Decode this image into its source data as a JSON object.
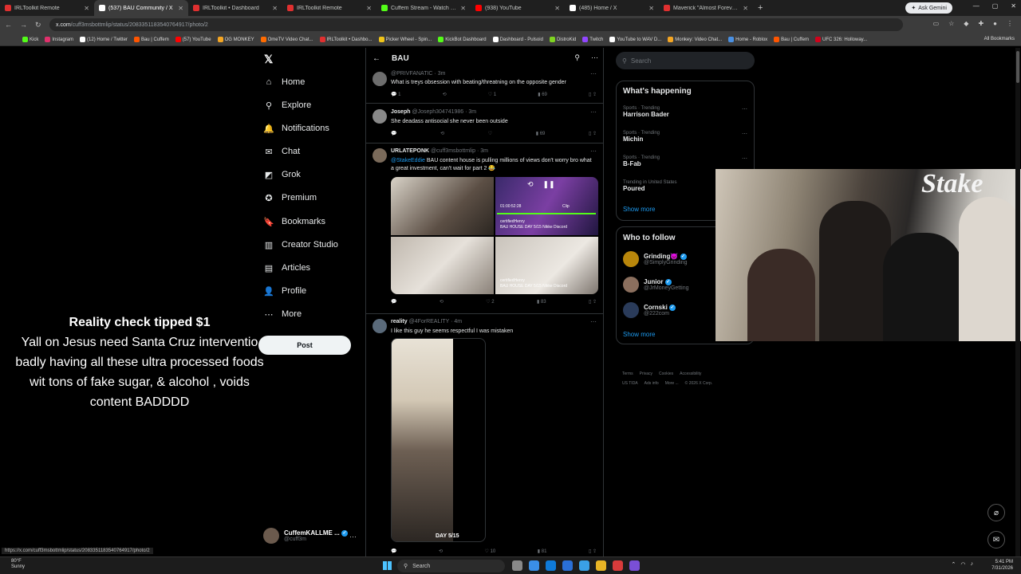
{
  "browser": {
    "tabs": [
      {
        "title": "IRLToolkit Remote",
        "color": "#e03030",
        "active": false
      },
      {
        "title": "(537) BAU Community / X",
        "color": "#ffffff",
        "active": true
      },
      {
        "title": "IRLToolkit • Dashboard",
        "color": "#e03030",
        "active": false
      },
      {
        "title": "IRLToolkit Remote",
        "color": "#e03030",
        "active": false
      },
      {
        "title": "Cuffem Stream - Watch Live on",
        "color": "#53fc18",
        "active": false
      },
      {
        "title": "(938) YouTube",
        "color": "#ff0000",
        "active": false
      },
      {
        "title": "(485) Home / X",
        "color": "#ffffff",
        "active": false
      },
      {
        "title": "Maverick \"Almost Forever\" EP",
        "color": "#e03030",
        "active": false
      }
    ],
    "ask_gemini": "Ask Gemini",
    "url_host": "x.com",
    "url_path": "/cuff3msbottmlip/status/2083351183540764917/photo/2",
    "bookmarks": [
      {
        "label": "Kick",
        "color": "#53fc18"
      },
      {
        "label": "Instagram",
        "color": "#e1306c"
      },
      {
        "label": "(12) Home / Twitter",
        "color": "#ffffff"
      },
      {
        "label": "Bau | Cuffem",
        "color": "#ff5500"
      },
      {
        "label": "(57) YouTube",
        "color": "#ff0000"
      },
      {
        "label": "OG MONKEY",
        "color": "#f5a623"
      },
      {
        "label": "OmeTV Video Chat...",
        "color": "#ff6b00"
      },
      {
        "label": "IRLToolkit • Dashbo...",
        "color": "#e03030"
      },
      {
        "label": "Picker Wheel - Spin...",
        "color": "#f0c419"
      },
      {
        "label": "KickBot Dashboard",
        "color": "#53fc18"
      },
      {
        "label": "Dashboard - Pulsoid",
        "color": "#ffffff"
      },
      {
        "label": "DistroKid",
        "color": "#7ed321"
      },
      {
        "label": "Twitch",
        "color": "#9146ff"
      },
      {
        "label": "YouTube to WAV D...",
        "color": "#ffffff"
      },
      {
        "label": "Monkey: Video Chat...",
        "color": "#f5a623"
      },
      {
        "label": "Home - Roblox",
        "color": "#4a90e2"
      },
      {
        "label": "Bau | Cuffem",
        "color": "#ff5500"
      },
      {
        "label": "UFC 326: Holloway...",
        "color": "#d0021b"
      }
    ],
    "all_bookmarks": "All Bookmarks",
    "status_url": "https://x.com/cuff3msbottmlip/status/2083351183540764917/photo/2"
  },
  "nav": {
    "items": [
      {
        "label": "Home",
        "icon": "⌂"
      },
      {
        "label": "Explore",
        "icon": "⚲"
      },
      {
        "label": "Notifications",
        "icon": "🔔"
      },
      {
        "label": "Chat",
        "icon": "✉"
      },
      {
        "label": "Grok",
        "icon": "◩"
      },
      {
        "label": "Premium",
        "icon": "✪"
      },
      {
        "label": "Bookmarks",
        "icon": "🔖"
      },
      {
        "label": "Creator Studio",
        "icon": "▥"
      },
      {
        "label": "Articles",
        "icon": "▤"
      },
      {
        "label": "Profile",
        "icon": "👤"
      },
      {
        "label": "More",
        "icon": "⋯"
      }
    ],
    "post": "Post",
    "account_name": "CuffemKALLME ...",
    "account_handle": "@cuff3m"
  },
  "overlay": {
    "title": "Reality check tipped $1",
    "lines": [
      "Yall on Jesus need Santa Cruz interventio",
      "badly having all these ultra processed foods",
      "wit tons of fake sugar, & alcohol , voids",
      "content BADDDD"
    ]
  },
  "column": {
    "title": "BAU",
    "tweets": [
      {
        "name": "",
        "handle": "@PRIVFANATIC · 3m",
        "text": "What is treys obsession with beating/threatning on the opposite gender",
        "reply": "1",
        "retweet": "",
        "like": "1",
        "views": "69"
      },
      {
        "name": "Joseph",
        "handle": "@Joseph304741986 · 3m",
        "text": "She deadass antisocial she never been outside",
        "reply": "",
        "retweet": "",
        "like": "",
        "views": "69"
      },
      {
        "name": "URLATEPONK",
        "handle": "@cuff3msbottmlip · 3m",
        "mention": "@StakeEddie",
        "text": "BAU content house is pulling millions of views don't worry bro what a great investment, can't wait for part 2 😂",
        "reply": "",
        "retweet": "",
        "like": "2",
        "views": "83",
        "media_tag1": "certifiedHenry",
        "media_tag1b": "BAU HOUSE DAY 5/15 Nikke Discord",
        "media_tag2": "certifiedHenry",
        "media_tag2b": "BAU HOUSE DAY 5/15 Nikke Discord",
        "video_time": "01:00:52:28",
        "clip": "Clip"
      },
      {
        "name": "reality",
        "handle": "@4ForREALITY · 4m",
        "text": "I like this guy he seems respectful I was mistaken",
        "reply": "",
        "retweet": "",
        "like": "10",
        "views": "81",
        "day_label": "DAY 5/15"
      }
    ]
  },
  "right": {
    "search_placeholder": "Search",
    "happening_title": "What's happening",
    "trends": [
      {
        "category": "Sports · Trending",
        "name": "Harrison Bader"
      },
      {
        "category": "Sports · Trending",
        "name": "Michin"
      },
      {
        "category": "Sports · Trending",
        "name": "B-Fab"
      },
      {
        "category": "Trending in United States",
        "name": "Poured"
      }
    ],
    "show_more": "Show more",
    "follow_title": "Who to follow",
    "follows": [
      {
        "name": "Grinding😈",
        "handle": "@SimplyGrinding",
        "color": "#b8860b"
      },
      {
        "name": "Junior",
        "handle": "@JrMoneyGetting",
        "color": "#8b6f5e"
      },
      {
        "name": "Cornski",
        "handle": "@222com",
        "color": "#2a3b5a"
      }
    ],
    "follow_show_more": "Show more",
    "footer": [
      "Terms",
      "Privacy",
      "Cookies",
      "Accessibility",
      "US TIDA",
      "Ads info",
      "More ...",
      "© 2026 X Corp."
    ]
  },
  "camera": {
    "sign": "Stake"
  },
  "taskbar": {
    "temp": "80°F",
    "weather": "Sunny",
    "search": "Search",
    "time": "5:41 PM",
    "date": "7/31/2026"
  }
}
